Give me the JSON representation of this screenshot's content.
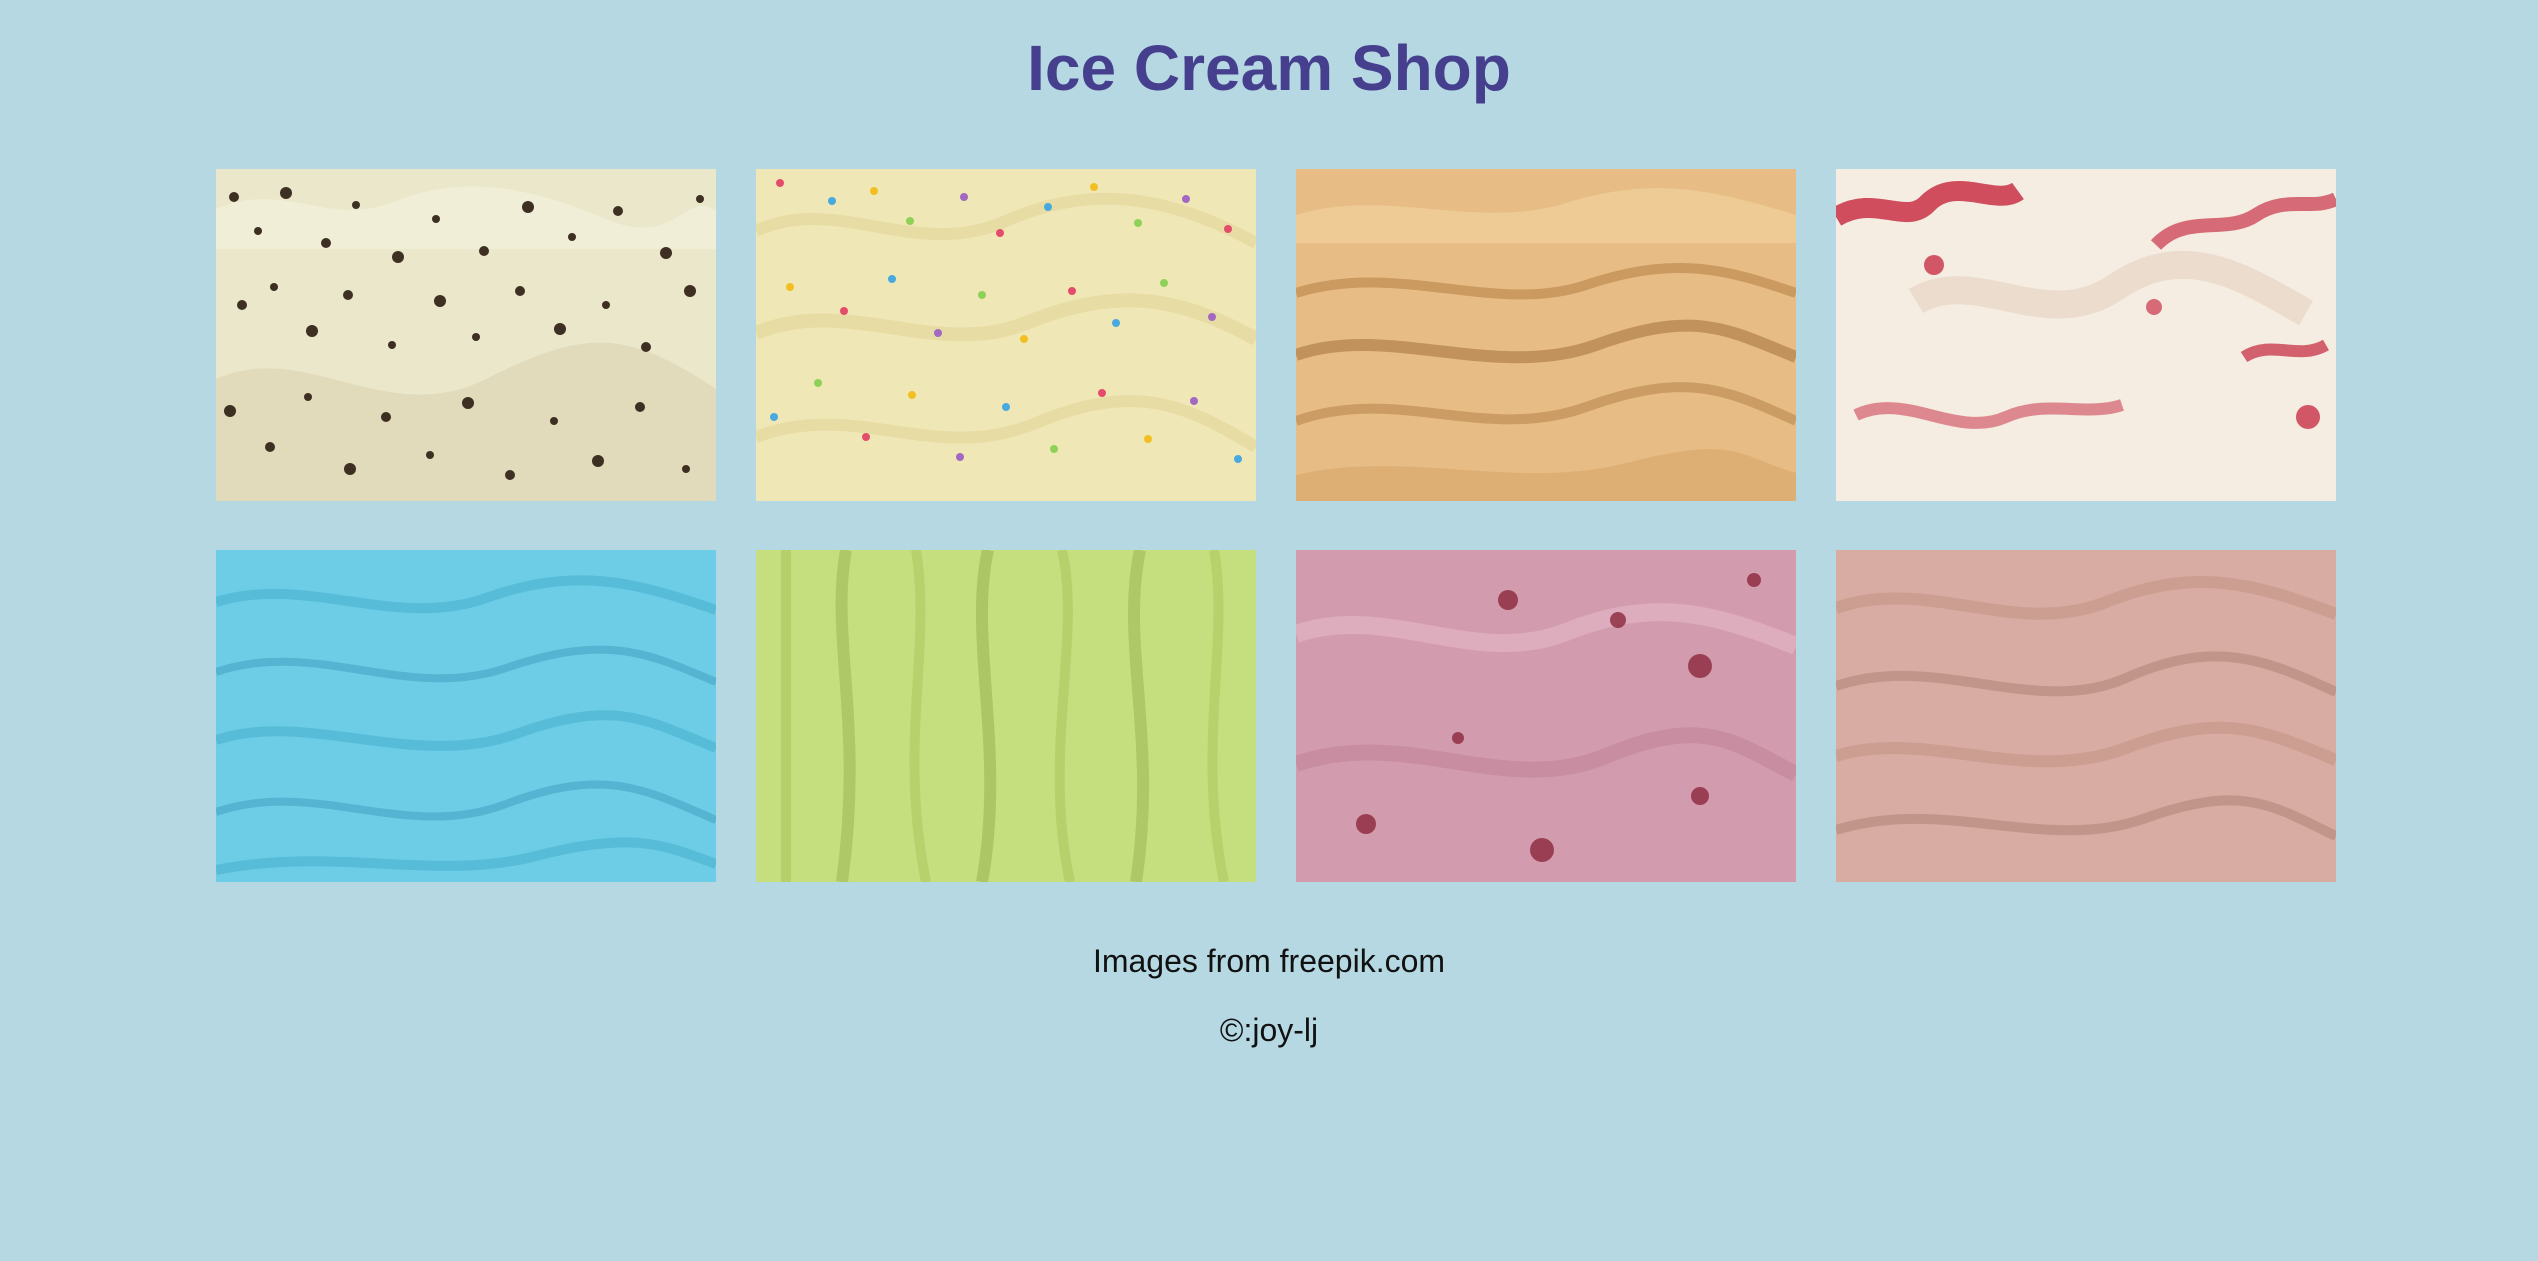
{
  "header": {
    "title": "Ice Cream Shop"
  },
  "gallery": {
    "images": [
      {
        "icon": "mint-chocolate-chip-ice-cream",
        "base": "#ece8cf",
        "accent": "#3a2c1f"
      },
      {
        "icon": "vanilla-sprinkles-ice-cream",
        "base": "#f0e6b6",
        "accent": "#e34d6b"
      },
      {
        "icon": "caramel-ice-cream",
        "base": "#e7bd85",
        "accent": "#a9743f"
      },
      {
        "icon": "strawberry-swirl-ice-cream",
        "base": "#f5ece0",
        "accent": "#c5243c"
      },
      {
        "icon": "blue-ice-cream",
        "base": "#6dcde6",
        "accent": "#3b9cbc"
      },
      {
        "icon": "pistachio-ice-cream",
        "base": "#c6df7e",
        "accent": "#8ea846"
      },
      {
        "icon": "berry-ice-cream",
        "base": "#d39cae",
        "accent": "#8e2b3f"
      },
      {
        "icon": "chocolate-milk-ice-cream",
        "base": "#d8aca2",
        "accent": "#a87a6d"
      }
    ]
  },
  "footer": {
    "source": "Images from freepik.com",
    "copyright": "©:joy-lj"
  },
  "colors": {
    "background": "#b5d8e3",
    "title": "#463f8e",
    "text": "#111111"
  }
}
